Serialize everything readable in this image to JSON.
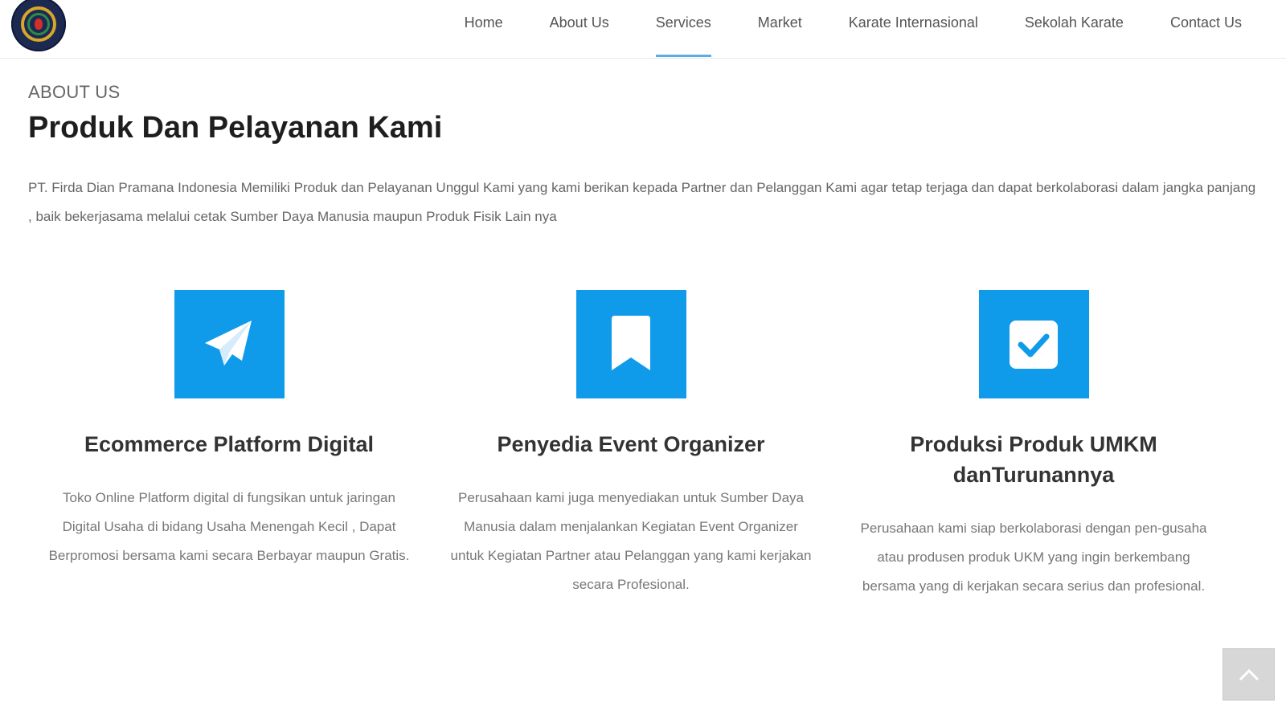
{
  "colors": {
    "accent": "#0f9be9",
    "nav_underline": "#5aaee8"
  },
  "header": {
    "logo_icon": "company-seal-logo",
    "nav": [
      {
        "label": "Home"
      },
      {
        "label": "About Us"
      },
      {
        "label": "Services",
        "active": true
      },
      {
        "label": "Market"
      },
      {
        "label": "Karate Internasional"
      },
      {
        "label": "Sekolah Karate"
      },
      {
        "label": "Contact Us"
      }
    ]
  },
  "section": {
    "eyebrow": "ABOUT US",
    "title": "Produk Dan Pelayanan Kami",
    "intro": "PT. Firda Dian Pramana Indonesia Memiliki Produk dan Pelayanan Unggul Kami yang kami berikan kepada Partner dan Pelanggan Kami agar tetap terjaga dan dapat berkolaborasi dalam jangka panjang , baik bekerjasama melalui cetak Sumber Daya Manusia maupun Produk Fisik Lain nya"
  },
  "cards": [
    {
      "icon": "paper-plane-icon",
      "title": "Ecommerce Platform Digital",
      "text": "Toko Online Platform digital di fungsikan untuk jaringan Digital Usaha di bidang Usaha Menengah Kecil , Dapat Berpromosi bersama kami secara Berbayar maupun Gratis."
    },
    {
      "icon": "bookmark-icon",
      "title": "Penyedia Event Organizer",
      "text": "Perusahaan kami juga menyediakan untuk Sumber Daya Manusia dalam menjalankan Kegiatan Event Organizer untuk Kegiatan Partner atau Pelanggan yang kami kerjakan secara Profesional."
    },
    {
      "icon": "check-square-icon",
      "title": "Produksi Produk UMKM danTurunannya",
      "text": "Perusahaan kami siap berkolaborasi dengan pen-gusaha atau produsen produk UKM yang ingin berkembang bersama yang di kerjakan secara serius dan profesional."
    }
  ],
  "back_to_top_icon": "chevron-up-icon"
}
